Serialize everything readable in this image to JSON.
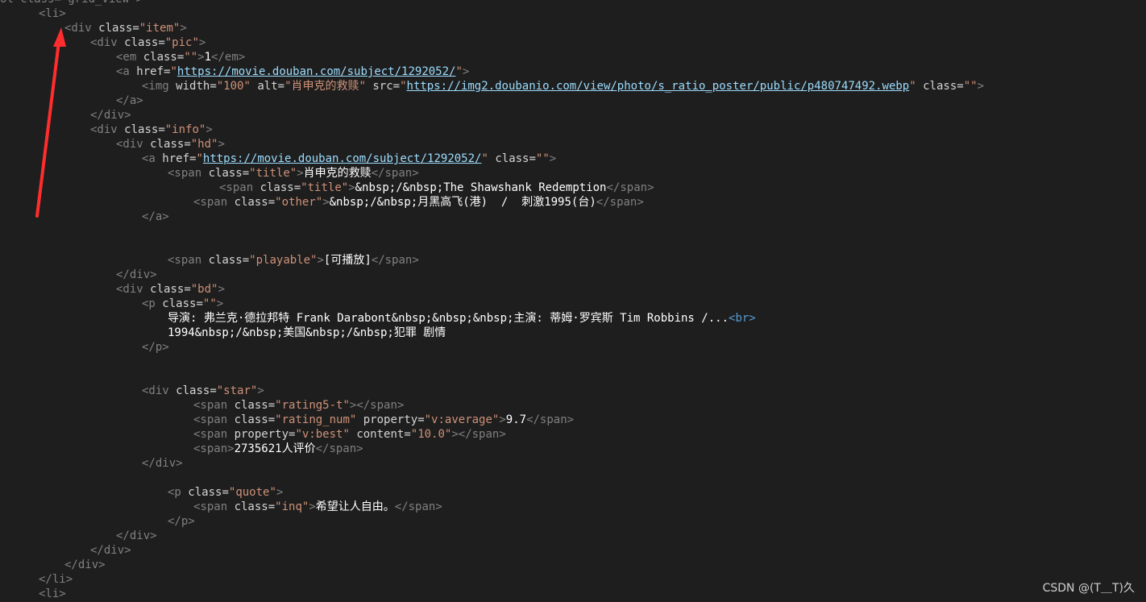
{
  "colors": {
    "background": "#1e1e1e",
    "tag": "#808080",
    "attribute": "#d4d4d4",
    "string": "#ce9178",
    "link": "#9cdcfe",
    "text": "#ffffff",
    "br_tag": "#569cd6",
    "arrow": "#ff2d2d"
  },
  "code_lines": [
    {
      "indent": 0,
      "segments": [
        {
          "t": "ol class=\"grid_view\">",
          "k": "tag"
        }
      ]
    },
    {
      "indent": 3,
      "segments": [
        {
          "t": "<li>",
          "k": "tag"
        }
      ]
    },
    {
      "indent": 5,
      "segments": [
        {
          "t": "<div ",
          "k": "tag"
        },
        {
          "t": "class",
          "k": "attr"
        },
        {
          "t": "=",
          "k": "eq"
        },
        {
          "t": "\"item\"",
          "k": "str"
        },
        {
          "t": ">",
          "k": "tag"
        }
      ]
    },
    {
      "indent": 7,
      "segments": [
        {
          "t": "<div ",
          "k": "tag"
        },
        {
          "t": "class",
          "k": "attr"
        },
        {
          "t": "=",
          "k": "eq"
        },
        {
          "t": "\"pic\"",
          "k": "str"
        },
        {
          "t": ">",
          "k": "tag"
        }
      ]
    },
    {
      "indent": 9,
      "segments": [
        {
          "t": "<em ",
          "k": "tag"
        },
        {
          "t": "class",
          "k": "attr"
        },
        {
          "t": "=",
          "k": "eq"
        },
        {
          "t": "\"\"",
          "k": "str"
        },
        {
          "t": ">",
          "k": "tag"
        },
        {
          "t": "1",
          "k": "text"
        },
        {
          "t": "</em>",
          "k": "tag"
        }
      ]
    },
    {
      "indent": 9,
      "segments": [
        {
          "t": "<a ",
          "k": "tag"
        },
        {
          "t": "href",
          "k": "attr"
        },
        {
          "t": "=",
          "k": "eq"
        },
        {
          "t": "\"",
          "k": "str"
        },
        {
          "t": "https://movie.douban.com/subject/1292052/",
          "k": "link"
        },
        {
          "t": "\"",
          "k": "str"
        },
        {
          "t": ">",
          "k": "tag"
        }
      ]
    },
    {
      "indent": 11,
      "segments": [
        {
          "t": "<img ",
          "k": "tag"
        },
        {
          "t": "width",
          "k": "attr"
        },
        {
          "t": "=",
          "k": "eq"
        },
        {
          "t": "\"100\"",
          "k": "str"
        },
        {
          "t": " alt",
          "k": "attr"
        },
        {
          "t": "=",
          "k": "eq"
        },
        {
          "t": "\"肖申克的救赎\"",
          "k": "str"
        },
        {
          "t": " src",
          "k": "attr"
        },
        {
          "t": "=",
          "k": "eq"
        },
        {
          "t": "\"",
          "k": "str"
        },
        {
          "t": "https://img2.doubanio.com/view/photo/s_ratio_poster/public/p480747492.webp",
          "k": "link"
        },
        {
          "t": "\"",
          "k": "str"
        },
        {
          "t": " class",
          "k": "attr"
        },
        {
          "t": "=",
          "k": "eq"
        },
        {
          "t": "\"\"",
          "k": "str"
        },
        {
          "t": ">",
          "k": "tag"
        }
      ]
    },
    {
      "indent": 9,
      "segments": [
        {
          "t": "</a>",
          "k": "tag"
        }
      ]
    },
    {
      "indent": 7,
      "segments": [
        {
          "t": "</div>",
          "k": "tag"
        }
      ]
    },
    {
      "indent": 7,
      "segments": [
        {
          "t": "<div ",
          "k": "tag"
        },
        {
          "t": "class",
          "k": "attr"
        },
        {
          "t": "=",
          "k": "eq"
        },
        {
          "t": "\"info\"",
          "k": "str"
        },
        {
          "t": ">",
          "k": "tag"
        }
      ]
    },
    {
      "indent": 9,
      "segments": [
        {
          "t": "<div ",
          "k": "tag"
        },
        {
          "t": "class",
          "k": "attr"
        },
        {
          "t": "=",
          "k": "eq"
        },
        {
          "t": "\"hd\"",
          "k": "str"
        },
        {
          "t": ">",
          "k": "tag"
        }
      ]
    },
    {
      "indent": 11,
      "segments": [
        {
          "t": "<a ",
          "k": "tag"
        },
        {
          "t": "href",
          "k": "attr"
        },
        {
          "t": "=",
          "k": "eq"
        },
        {
          "t": "\"",
          "k": "str"
        },
        {
          "t": "https://movie.douban.com/subject/1292052/",
          "k": "link"
        },
        {
          "t": "\"",
          "k": "str"
        },
        {
          "t": " class",
          "k": "attr"
        },
        {
          "t": "=",
          "k": "eq"
        },
        {
          "t": "\"\"",
          "k": "str"
        },
        {
          "t": ">",
          "k": "tag"
        }
      ]
    },
    {
      "indent": 13,
      "segments": [
        {
          "t": "<span ",
          "k": "tag"
        },
        {
          "t": "class",
          "k": "attr"
        },
        {
          "t": "=",
          "k": "eq"
        },
        {
          "t": "\"title\"",
          "k": "str"
        },
        {
          "t": ">",
          "k": "tag"
        },
        {
          "t": "肖申克的救赎",
          "k": "text"
        },
        {
          "t": "</span>",
          "k": "tag"
        }
      ]
    },
    {
      "indent": 17,
      "segments": [
        {
          "t": "<span ",
          "k": "tag"
        },
        {
          "t": "class",
          "k": "attr"
        },
        {
          "t": "=",
          "k": "eq"
        },
        {
          "t": "\"title\"",
          "k": "str"
        },
        {
          "t": ">",
          "k": "tag"
        },
        {
          "t": "&nbsp;/&nbsp;The Shawshank Redemption",
          "k": "text"
        },
        {
          "t": "</span>",
          "k": "tag"
        }
      ]
    },
    {
      "indent": 15,
      "segments": [
        {
          "t": "<span ",
          "k": "tag"
        },
        {
          "t": "class",
          "k": "attr"
        },
        {
          "t": "=",
          "k": "eq"
        },
        {
          "t": "\"other\"",
          "k": "str"
        },
        {
          "t": ">",
          "k": "tag"
        },
        {
          "t": "&nbsp;/&nbsp;月黑高飞(港)  /  刺激1995(台)",
          "k": "text"
        },
        {
          "t": "</span>",
          "k": "tag"
        }
      ]
    },
    {
      "indent": 11,
      "segments": [
        {
          "t": "</a>",
          "k": "tag"
        }
      ]
    },
    {
      "indent": 0,
      "segments": []
    },
    {
      "indent": 0,
      "segments": []
    },
    {
      "indent": 13,
      "segments": [
        {
          "t": "<span ",
          "k": "tag"
        },
        {
          "t": "class",
          "k": "attr"
        },
        {
          "t": "=",
          "k": "eq"
        },
        {
          "t": "\"playable\"",
          "k": "str"
        },
        {
          "t": ">",
          "k": "tag"
        },
        {
          "t": "[可播放]",
          "k": "text"
        },
        {
          "t": "</span>",
          "k": "tag"
        }
      ]
    },
    {
      "indent": 9,
      "segments": [
        {
          "t": "</div>",
          "k": "tag"
        }
      ]
    },
    {
      "indent": 9,
      "segments": [
        {
          "t": "<div ",
          "k": "tag"
        },
        {
          "t": "class",
          "k": "attr"
        },
        {
          "t": "=",
          "k": "eq"
        },
        {
          "t": "\"bd\"",
          "k": "str"
        },
        {
          "t": ">",
          "k": "tag"
        }
      ]
    },
    {
      "indent": 11,
      "segments": [
        {
          "t": "<p ",
          "k": "tag"
        },
        {
          "t": "class",
          "k": "attr"
        },
        {
          "t": "=",
          "k": "eq"
        },
        {
          "t": "\"\"",
          "k": "str"
        },
        {
          "t": ">",
          "k": "tag"
        }
      ]
    },
    {
      "indent": 13,
      "segments": [
        {
          "t": "导演: 弗兰克·德拉邦特 Frank Darabont&nbsp;&nbsp;&nbsp;主演: 蒂姆·罗宾斯 Tim Robbins /...",
          "k": "text"
        },
        {
          "t": "<br>",
          "k": "br"
        }
      ]
    },
    {
      "indent": 13,
      "segments": [
        {
          "t": "1994&nbsp;/&nbsp;美国&nbsp;/&nbsp;犯罪 剧情",
          "k": "text"
        }
      ]
    },
    {
      "indent": 11,
      "segments": [
        {
          "t": "</p>",
          "k": "tag"
        }
      ]
    },
    {
      "indent": 0,
      "segments": []
    },
    {
      "indent": 0,
      "segments": []
    },
    {
      "indent": 11,
      "segments": [
        {
          "t": "<div ",
          "k": "tag"
        },
        {
          "t": "class",
          "k": "attr"
        },
        {
          "t": "=",
          "k": "eq"
        },
        {
          "t": "\"star\"",
          "k": "str"
        },
        {
          "t": ">",
          "k": "tag"
        }
      ]
    },
    {
      "indent": 15,
      "segments": [
        {
          "t": "<span ",
          "k": "tag"
        },
        {
          "t": "class",
          "k": "attr"
        },
        {
          "t": "=",
          "k": "eq"
        },
        {
          "t": "\"rating5-t\"",
          "k": "str"
        },
        {
          "t": "></span>",
          "k": "tag"
        }
      ]
    },
    {
      "indent": 15,
      "segments": [
        {
          "t": "<span ",
          "k": "tag"
        },
        {
          "t": "class",
          "k": "attr"
        },
        {
          "t": "=",
          "k": "eq"
        },
        {
          "t": "\"rating_num\"",
          "k": "str"
        },
        {
          "t": " property",
          "k": "attr"
        },
        {
          "t": "=",
          "k": "eq"
        },
        {
          "t": "\"v:average\"",
          "k": "str"
        },
        {
          "t": ">",
          "k": "tag"
        },
        {
          "t": "9.7",
          "k": "text"
        },
        {
          "t": "</span>",
          "k": "tag"
        }
      ]
    },
    {
      "indent": 15,
      "segments": [
        {
          "t": "<span ",
          "k": "tag"
        },
        {
          "t": "property",
          "k": "attr"
        },
        {
          "t": "=",
          "k": "eq"
        },
        {
          "t": "\"v:best\"",
          "k": "str"
        },
        {
          "t": " content",
          "k": "attr"
        },
        {
          "t": "=",
          "k": "eq"
        },
        {
          "t": "\"10.0\"",
          "k": "str"
        },
        {
          "t": "></span>",
          "k": "tag"
        }
      ]
    },
    {
      "indent": 15,
      "segments": [
        {
          "t": "<span>",
          "k": "tag"
        },
        {
          "t": "2735621人评价",
          "k": "text"
        },
        {
          "t": "</span>",
          "k": "tag"
        }
      ]
    },
    {
      "indent": 11,
      "segments": [
        {
          "t": "</div>",
          "k": "tag"
        }
      ]
    },
    {
      "indent": 0,
      "segments": []
    },
    {
      "indent": 13,
      "segments": [
        {
          "t": "<p ",
          "k": "tag"
        },
        {
          "t": "class",
          "k": "attr"
        },
        {
          "t": "=",
          "k": "eq"
        },
        {
          "t": "\"quote\"",
          "k": "str"
        },
        {
          "t": ">",
          "k": "tag"
        }
      ]
    },
    {
      "indent": 15,
      "segments": [
        {
          "t": "<span ",
          "k": "tag"
        },
        {
          "t": "class",
          "k": "attr"
        },
        {
          "t": "=",
          "k": "eq"
        },
        {
          "t": "\"inq\"",
          "k": "str"
        },
        {
          "t": ">",
          "k": "tag"
        },
        {
          "t": "希望让人自由。",
          "k": "text"
        },
        {
          "t": "</span>",
          "k": "tag"
        }
      ]
    },
    {
      "indent": 13,
      "segments": [
        {
          "t": "</p>",
          "k": "tag"
        }
      ]
    },
    {
      "indent": 9,
      "segments": [
        {
          "t": "</div>",
          "k": "tag"
        }
      ]
    },
    {
      "indent": 7,
      "segments": [
        {
          "t": "</div>",
          "k": "tag"
        }
      ]
    },
    {
      "indent": 5,
      "segments": [
        {
          "t": "</div>",
          "k": "tag"
        }
      ]
    },
    {
      "indent": 3,
      "segments": [
        {
          "t": "</li>",
          "k": "tag"
        }
      ]
    },
    {
      "indent": 3,
      "segments": [
        {
          "t": "<li>",
          "k": "tag"
        }
      ]
    }
  ],
  "watermark": "CSDN @(T＿T)久"
}
